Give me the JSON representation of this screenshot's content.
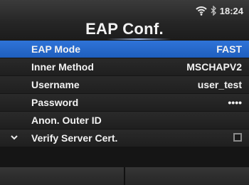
{
  "header": {
    "title": "EAP Conf.",
    "time": "18:24",
    "wifi_icon": "wifi-icon",
    "bluetooth_icon": "bluetooth-icon"
  },
  "menu": {
    "items": [
      {
        "label": "EAP Mode",
        "value": "FAST",
        "selected": true
      },
      {
        "label": "Inner Method",
        "value": "MSCHAPV2"
      },
      {
        "label": "Username",
        "value": "user_test"
      },
      {
        "label": "Password",
        "value": "••••"
      },
      {
        "label": "Anon. Outer ID",
        "value": ""
      },
      {
        "label": "Verify Server Cert.",
        "checked": false
      }
    ],
    "scroll_indicator_icon": "chevron-down-icon"
  },
  "colors": {
    "selected_row": "#2f73d8",
    "background": "#151515"
  }
}
